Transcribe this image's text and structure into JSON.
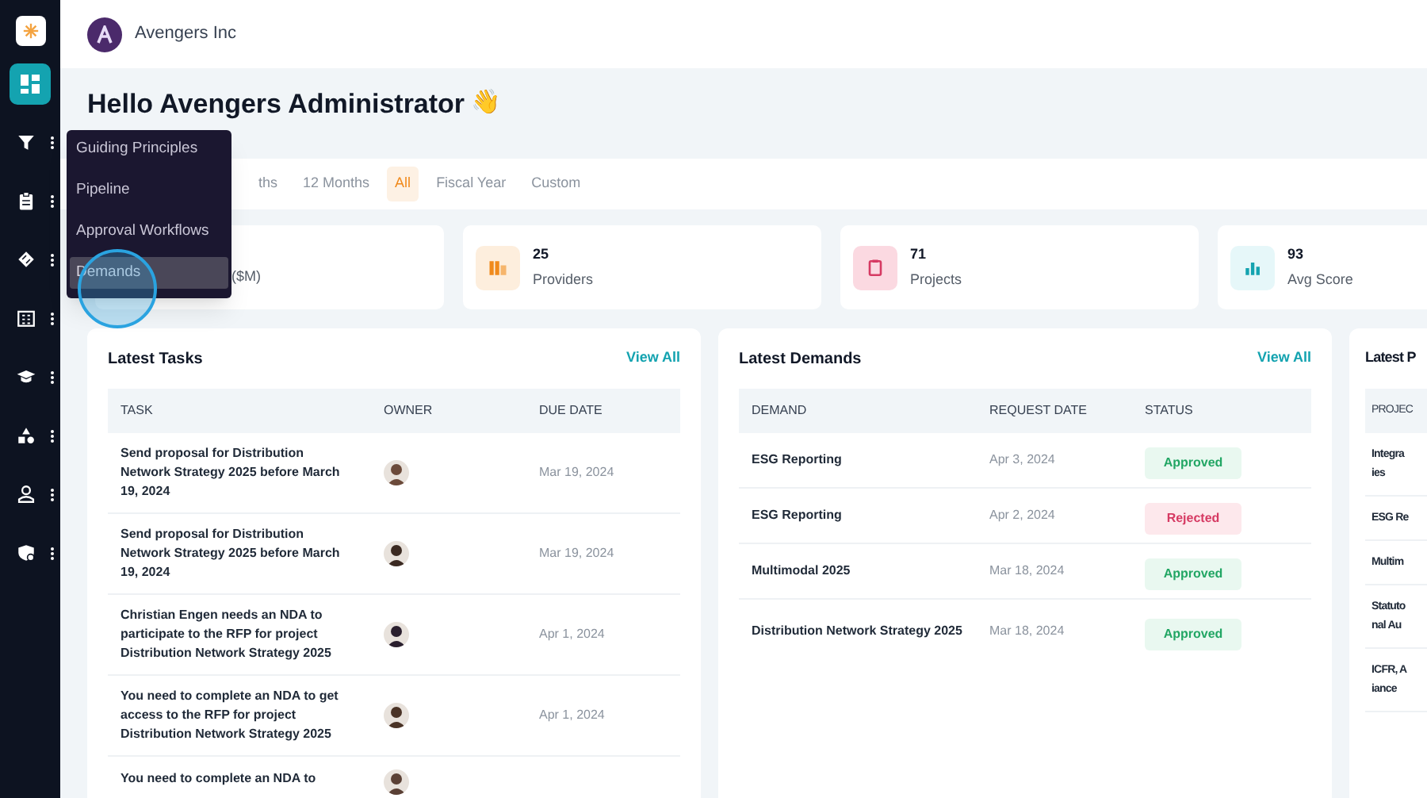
{
  "sidebar": {
    "items": [
      {
        "selected": true
      },
      {
        "selected": false
      },
      {
        "selected": false
      },
      {
        "selected": false
      },
      {
        "selected": false
      },
      {
        "selected": false
      },
      {
        "selected": false
      },
      {
        "selected": false
      },
      {
        "selected": false
      }
    ]
  },
  "header": {
    "org": "Avengers Inc"
  },
  "greeting": {
    "title": "Hello Avengers Administrator",
    "emoji": "👋"
  },
  "period_tabs": [
    {
      "label": "ths",
      "selected": false
    },
    {
      "label": "12 Months",
      "selected": false
    },
    {
      "label": "All",
      "selected": true
    },
    {
      "label": "Fiscal Year",
      "selected": false
    },
    {
      "label": "Custom",
      "selected": false
    }
  ],
  "stats": [
    {
      "kind": "partial",
      "label": "($M)"
    },
    {
      "kind": "providers",
      "value": "25",
      "label": "Providers"
    },
    {
      "kind": "projects",
      "value": "71",
      "label": "Projects"
    },
    {
      "kind": "score",
      "value": "93",
      "label": "Avg Score"
    }
  ],
  "tasks": {
    "title": "Latest Tasks",
    "link": "View All",
    "columns": [
      "TASK",
      "OWNER",
      "DUE DATE"
    ],
    "rows": [
      {
        "task": "Send proposal for Distribution Network Strategy 2025 before March 19, 2024",
        "due": "Mar 19, 2024"
      },
      {
        "task": "Send proposal for Distribution Network Strategy 2025 before March 19, 2024",
        "due": "Mar 19, 2024"
      },
      {
        "task": "Christian Engen needs an NDA to participate to the RFP for project Distribution Network Strategy 2025",
        "due": "Apr 1, 2024"
      },
      {
        "task": "You need to complete an NDA to get access to the RFP for project Distribution Network Strategy 2025",
        "due": "Apr 1, 2024"
      },
      {
        "task": "You need to complete an NDA to"
      }
    ]
  },
  "demands": {
    "title": "Latest Demands",
    "link": "View All",
    "columns": [
      "DEMAND",
      "REQUEST DATE",
      "STATUS"
    ],
    "rows": [
      {
        "demand": "ESG Reporting",
        "date": "Apr 3, 2024",
        "status": "Approved",
        "kind": "approved"
      },
      {
        "demand": "ESG Reporting",
        "date": "Apr 2, 2024",
        "status": "Rejected",
        "kind": "rejected"
      },
      {
        "demand": "Multimodal 2025",
        "date": "Mar 18, 2024",
        "status": "Approved",
        "kind": "approved"
      },
      {
        "demand": "Distribution Network Strategy 2025",
        "date": "Mar 18, 2024",
        "status": "Approved",
        "kind": "approved"
      }
    ]
  },
  "projects": {
    "title": "Latest P",
    "column_1": "PROJEC",
    "rows": [
      {
        "lines": [
          "Integra",
          "ies"
        ]
      },
      {
        "lines": [
          "ESG Re"
        ]
      },
      {
        "lines": [
          "Multim"
        ]
      },
      {
        "lines": [
          "Statuto",
          "nal Au"
        ]
      },
      {
        "lines": [
          "ICFR, A",
          "iance"
        ]
      }
    ]
  },
  "menu": {
    "items": [
      {
        "label": "Guiding Principles",
        "selected": false
      },
      {
        "label": "Pipeline",
        "selected": false
      },
      {
        "label": "Approval Workflows",
        "selected": false
      },
      {
        "label": "Demands",
        "selected": true
      }
    ]
  }
}
